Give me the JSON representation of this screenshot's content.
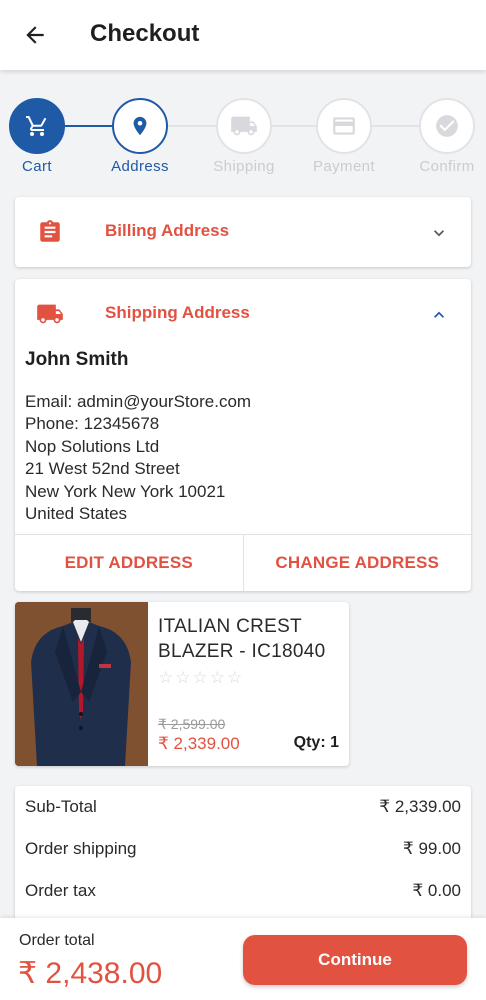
{
  "header": {
    "title": "Checkout"
  },
  "stepper": {
    "steps": [
      {
        "label": "Cart",
        "state": "done",
        "icon": "cart-icon"
      },
      {
        "label": "Address",
        "state": "current",
        "icon": "location-pin-icon"
      },
      {
        "label": "Shipping",
        "state": "pending",
        "icon": "truck-icon"
      },
      {
        "label": "Payment",
        "state": "pending",
        "icon": "credit-card-icon"
      },
      {
        "label": "Confirm",
        "state": "pending",
        "icon": "check-circle-icon"
      }
    ]
  },
  "billing": {
    "title": "Billing Address",
    "expanded": false,
    "icon": "clipboard-icon"
  },
  "shipping": {
    "title": "Shipping Address",
    "expanded": true,
    "icon": "truck-icon",
    "name": "John Smith",
    "lines": [
      "Email: admin@yourStore.com",
      "Phone: 12345678",
      "Nop Solutions Ltd",
      "21 West 52nd Street",
      "New York New York 10021",
      "United States"
    ],
    "edit_label": "EDIT ADDRESS",
    "change_label": "CHANGE ADDRESS"
  },
  "product": {
    "name": "ITALIAN CREST BLAZER - IC18040",
    "rating": 0,
    "rating_max": 5,
    "old_price": "₹ 2,599.00",
    "price": "₹ 2,339.00",
    "qty_label": "Qty: 1"
  },
  "summary": {
    "rows": [
      {
        "label": "Sub-Total",
        "value": "₹ 2,339.00"
      },
      {
        "label": "Order shipping",
        "value": "₹ 99.00"
      },
      {
        "label": "Order tax",
        "value": "₹ 0.00"
      }
    ]
  },
  "footer": {
    "total_label": "Order total",
    "total_value": "₹ 2,438.00",
    "continue_label": "Continue"
  },
  "colors": {
    "primary": "#1f5aa6",
    "accent": "#e15241",
    "inactive": "#c9ccd1"
  }
}
